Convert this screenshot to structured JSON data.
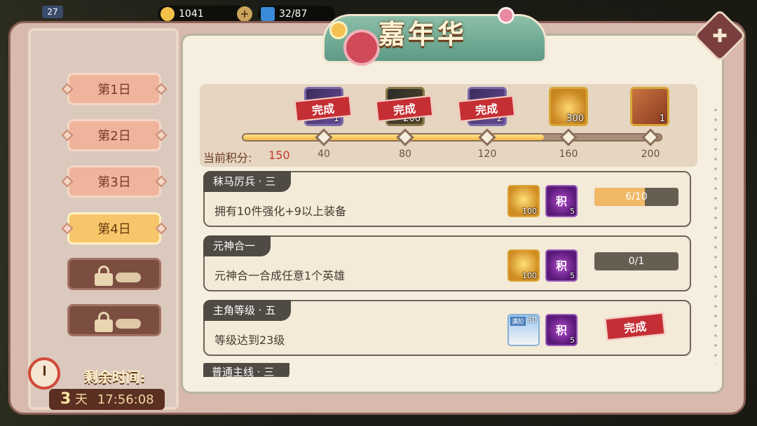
{
  "topbar": {
    "level": "27",
    "gold": "1041",
    "energy": "32/87",
    "plus_label": "+"
  },
  "title": "嘉年华",
  "close_label": "✚",
  "days": [
    {
      "label": "第1日",
      "state": "normal"
    },
    {
      "label": "第2日",
      "state": "normal"
    },
    {
      "label": "第3日",
      "state": "normal"
    },
    {
      "label": "第4日",
      "state": "active"
    },
    {
      "label": "",
      "state": "locked"
    },
    {
      "label": "",
      "state": "locked"
    }
  ],
  "remaining": {
    "label": "剩余时间:",
    "days": "3",
    "days_unit": "天",
    "time": "17:56:08"
  },
  "progress": {
    "score_label": "当前积分:",
    "score": "150",
    "fill": 0.72,
    "nodes": [
      "40",
      "80",
      "120",
      "160",
      "200"
    ],
    "rewards": [
      {
        "count": "1",
        "done": true,
        "stamp": "完成",
        "type": "purple"
      },
      {
        "count": "200",
        "done": true,
        "stamp": "完成",
        "type": "dark"
      },
      {
        "count": "2",
        "done": true,
        "stamp": "完成",
        "type": "purple"
      },
      {
        "count": "300",
        "done": false,
        "stamp": "",
        "type": "gold"
      },
      {
        "count": "1",
        "done": false,
        "stamp": "",
        "type": "scroll"
      }
    ]
  },
  "tasks": [
    {
      "title": "秣马厉兵 · 三",
      "desc": "拥有10件强化+9以上装备",
      "reward1": "100",
      "reward2_label": "积",
      "reward2": "5",
      "progress": "6/10",
      "fill": 0.6,
      "done": false
    },
    {
      "title": "元神合一",
      "desc": "元神合一合成任意1个英雄",
      "reward1": "100",
      "reward2_label": "积",
      "reward2": "5",
      "progress": "0/1",
      "fill": 0,
      "done": false
    },
    {
      "title": "主角等级 · 五",
      "desc": "等级达到23级",
      "reward1_top": "30",
      "reward1_tag": "满阶",
      "reward2_label": "积",
      "reward2": "5",
      "done_label": "完成",
      "done": true
    },
    {
      "title": "普通主线 · 三",
      "desc": ""
    }
  ]
}
